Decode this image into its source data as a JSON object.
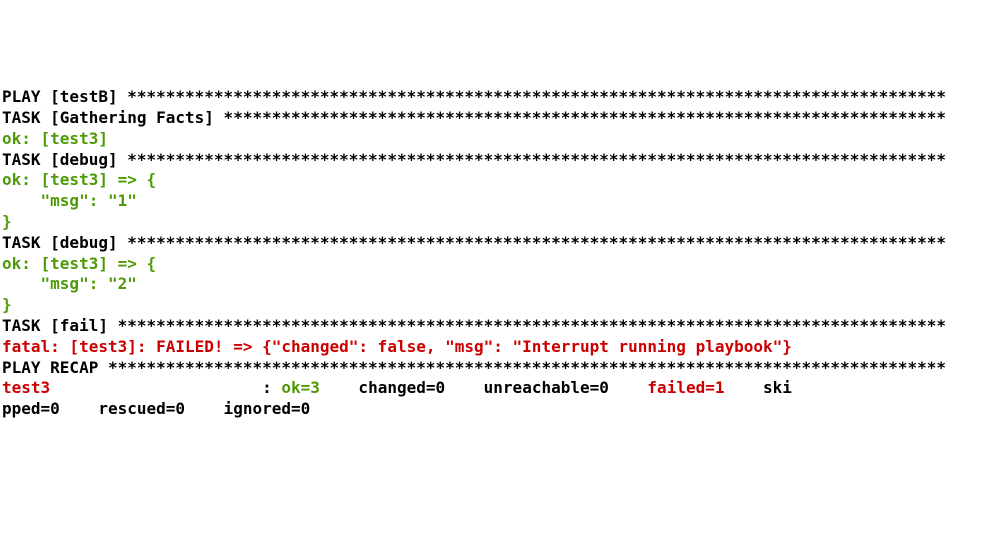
{
  "lines": [
    {
      "segments": [
        {
          "cls": "black",
          "text": "PLAY [testB] *************************************************************************************"
        }
      ]
    },
    {
      "segments": [
        {
          "cls": "black",
          "text": ""
        }
      ]
    },
    {
      "segments": [
        {
          "cls": "black",
          "text": "TASK [Gathering Facts] ***************************************************************************"
        }
      ]
    },
    {
      "segments": [
        {
          "cls": "green",
          "text": "ok: [test3]"
        }
      ]
    },
    {
      "segments": [
        {
          "cls": "black",
          "text": ""
        }
      ]
    },
    {
      "segments": [
        {
          "cls": "black",
          "text": "TASK [debug] *************************************************************************************"
        }
      ]
    },
    {
      "segments": [
        {
          "cls": "green",
          "text": "ok: [test3] => {"
        }
      ]
    },
    {
      "segments": [
        {
          "cls": "green",
          "text": "    \"msg\": \"1\""
        }
      ]
    },
    {
      "segments": [
        {
          "cls": "green",
          "text": "}"
        }
      ]
    },
    {
      "segments": [
        {
          "cls": "black",
          "text": ""
        }
      ]
    },
    {
      "segments": [
        {
          "cls": "black",
          "text": "TASK [debug] *************************************************************************************"
        }
      ]
    },
    {
      "segments": [
        {
          "cls": "green",
          "text": "ok: [test3] => {"
        }
      ]
    },
    {
      "segments": [
        {
          "cls": "green",
          "text": "    \"msg\": \"2\""
        }
      ]
    },
    {
      "segments": [
        {
          "cls": "green",
          "text": "}"
        }
      ]
    },
    {
      "segments": [
        {
          "cls": "black",
          "text": ""
        }
      ]
    },
    {
      "segments": [
        {
          "cls": "black",
          "text": "TASK [fail] **************************************************************************************"
        }
      ]
    },
    {
      "segments": [
        {
          "cls": "red",
          "text": "fatal: [test3]: FAILED! => {\"changed\": false, \"msg\": \"Interrupt running playbook\"}"
        }
      ]
    },
    {
      "segments": [
        {
          "cls": "black",
          "text": ""
        }
      ]
    },
    {
      "segments": [
        {
          "cls": "black",
          "text": "PLAY RECAP ***************************************************************************************"
        }
      ]
    },
    {
      "segments": [
        {
          "cls": "red",
          "text": "test3"
        },
        {
          "cls": "black",
          "text": "                      : "
        },
        {
          "cls": "green",
          "text": "ok=3   "
        },
        {
          "cls": "black",
          "text": " changed=0    unreachable=0    "
        },
        {
          "cls": "red",
          "text": "failed=1   "
        },
        {
          "cls": "black",
          "text": " ski"
        }
      ]
    },
    {
      "segments": [
        {
          "cls": "black",
          "text": "pped=0    rescued=0    ignored=0"
        }
      ]
    }
  ]
}
